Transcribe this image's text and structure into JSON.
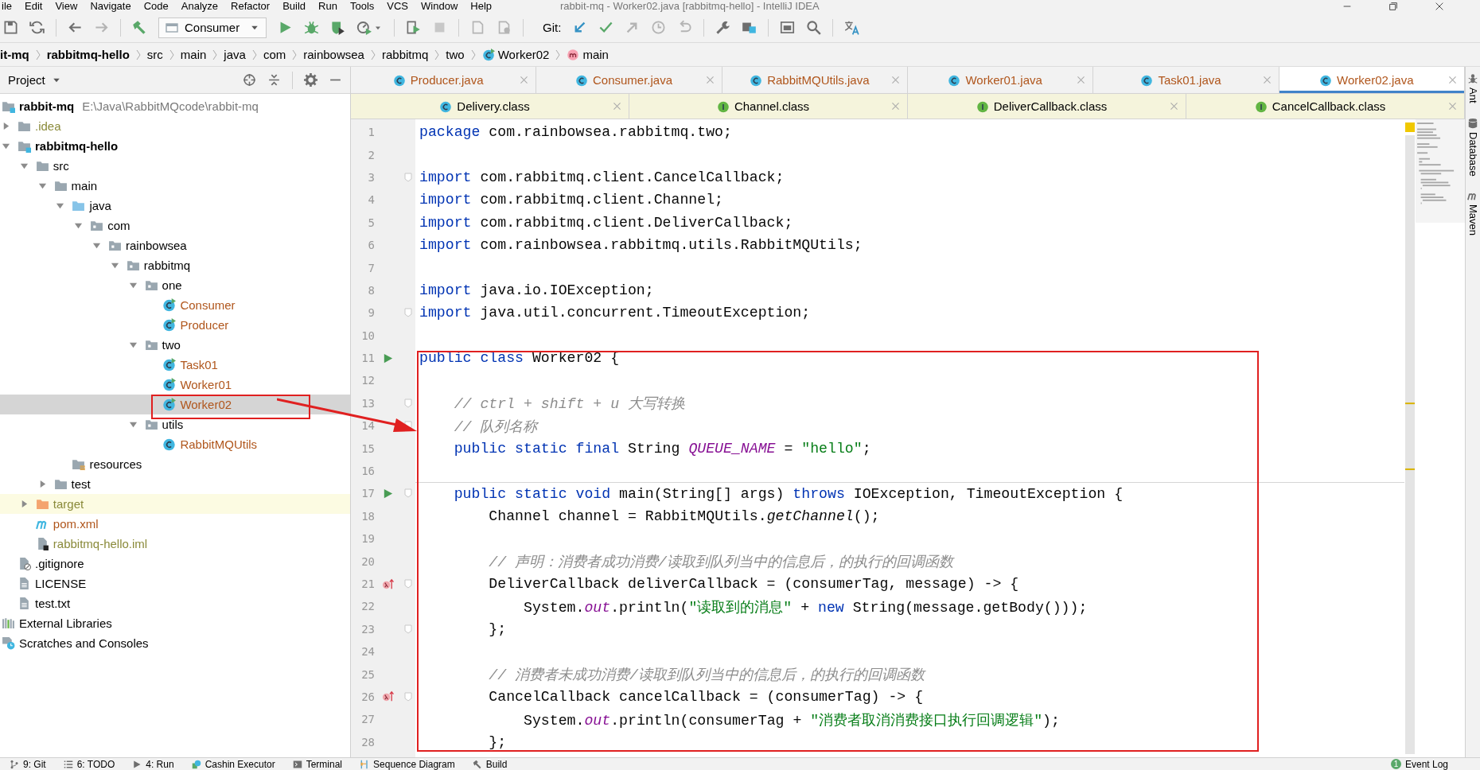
{
  "menu_bar": {
    "items": [
      "ile",
      "Edit",
      "View",
      "Navigate",
      "Code",
      "Analyze",
      "Refactor",
      "Build",
      "Run",
      "Tools",
      "VCS",
      "Window",
      "Help"
    ],
    "title": "rabbit-mq - Worker02.java [rabbitmq-hello] - IntelliJ IDEA"
  },
  "toolbar": {
    "run_configuration": "Consumer",
    "git_label": "Git:"
  },
  "breadcrumbs": [
    {
      "label": "it-mq",
      "kind": "module"
    },
    {
      "label": "rabbitmq-hello",
      "kind": "module"
    },
    {
      "label": "src",
      "kind": "folder"
    },
    {
      "label": "main",
      "kind": "folder"
    },
    {
      "label": "java",
      "kind": "folder"
    },
    {
      "label": "com",
      "kind": "folder"
    },
    {
      "label": "rainbowsea",
      "kind": "folder"
    },
    {
      "label": "rabbitmq",
      "kind": "folder"
    },
    {
      "label": "two",
      "kind": "folder"
    },
    {
      "label": "Worker02",
      "kind": "class"
    },
    {
      "label": "main",
      "kind": "method"
    }
  ],
  "project_panel": {
    "title": "Project",
    "tree": [
      {
        "label": "rabbit-mq",
        "path": "E:\\Java\\RabbitMQcode\\rabbit-mq",
        "kind": "module",
        "selected": false,
        "children": [
          {
            "label": ".idea",
            "kind": "folder",
            "expanded": false,
            "color": "#8a8a3a",
            "selected": false
          },
          {
            "label": "rabbitmq-hello",
            "kind": "module",
            "expanded": true,
            "selected": false,
            "children": [
              {
                "label": "src",
                "kind": "folder",
                "expanded": true,
                "selected": false,
                "children": [
                  {
                    "label": "main",
                    "kind": "folder",
                    "expanded": true,
                    "selected": false,
                    "children": [
                      {
                        "label": "java",
                        "kind": "source-folder",
                        "expanded": true,
                        "selected": false,
                        "children": [
                          {
                            "label": "com",
                            "kind": "package",
                            "expanded": true,
                            "selected": false,
                            "children": [
                              {
                                "label": "rainbowsea",
                                "kind": "package",
                                "expanded": true,
                                "selected": false,
                                "children": [
                                  {
                                    "label": "rabbitmq",
                                    "kind": "package",
                                    "expanded": true,
                                    "selected": false,
                                    "children": [
                                      {
                                        "label": "one",
                                        "kind": "package",
                                        "expanded": true,
                                        "selected": false,
                                        "children": [
                                          {
                                            "label": "Consumer",
                                            "kind": "runnable-class",
                                            "color": "#b0561c",
                                            "selected": false
                                          },
                                          {
                                            "label": "Producer",
                                            "kind": "runnable-class",
                                            "color": "#b0561c",
                                            "selected": false
                                          }
                                        ]
                                      },
                                      {
                                        "label": "two",
                                        "kind": "package",
                                        "expanded": true,
                                        "selected": false,
                                        "children": [
                                          {
                                            "label": "Task01",
                                            "kind": "runnable-class",
                                            "color": "#b0561c",
                                            "selected": false
                                          },
                                          {
                                            "label": "Worker01",
                                            "kind": "runnable-class",
                                            "color": "#b0561c",
                                            "selected": false
                                          },
                                          {
                                            "label": "Worker02",
                                            "kind": "runnable-class",
                                            "color": "#b0561c",
                                            "selected": true
                                          }
                                        ]
                                      },
                                      {
                                        "label": "utils",
                                        "kind": "package",
                                        "expanded": true,
                                        "selected": false,
                                        "children": [
                                          {
                                            "label": "RabbitMQUtils",
                                            "kind": "class",
                                            "color": "#b0561c",
                                            "selected": false
                                          }
                                        ]
                                      }
                                    ]
                                  }
                                ]
                              }
                            ]
                          }
                        ]
                      },
                      {
                        "label": "resources",
                        "kind": "resources-folder",
                        "selected": false
                      }
                    ]
                  },
                  {
                    "label": "test",
                    "kind": "folder",
                    "expanded": false,
                    "selected": false
                  }
                ]
              },
              {
                "label": "target",
                "kind": "excluded-folder",
                "expanded": false,
                "color": "#8a8a3a",
                "selected": false
              },
              {
                "label": "pom.xml",
                "kind": "maven-file",
                "color": "#b0561c",
                "selected": false
              },
              {
                "label": "rabbitmq-hello.iml",
                "kind": "iml-file",
                "color": "#8a8a3a",
                "selected": false
              }
            ]
          },
          {
            "label": ".gitignore",
            "kind": "ignore-file",
            "selected": false
          },
          {
            "label": "LICENSE",
            "kind": "text-file",
            "selected": false
          },
          {
            "label": "test.txt",
            "kind": "text-file",
            "selected": false
          }
        ]
      },
      {
        "label": "External Libraries",
        "kind": "libraries",
        "selected": false
      },
      {
        "label": "Scratches and Consoles",
        "kind": "scratches",
        "selected": false
      }
    ]
  },
  "tab_rows": [
    {
      "tabs": [
        {
          "label": "Producer.java",
          "kind": "class",
          "color": "#b0561c",
          "library": false,
          "selected": false
        },
        {
          "label": "Consumer.java",
          "kind": "class",
          "color": "#b0561c",
          "library": false,
          "selected": false
        },
        {
          "label": "RabbitMQUtils.java",
          "kind": "class",
          "color": "#b0561c",
          "library": false,
          "selected": false
        },
        {
          "label": "Worker01.java",
          "kind": "class",
          "color": "#b0561c",
          "library": false,
          "selected": false
        },
        {
          "label": "Task01.java",
          "kind": "class",
          "color": "#b0561c",
          "library": false,
          "selected": false
        },
        {
          "label": "Worker02.java",
          "kind": "class",
          "color": "#b0561c",
          "library": false,
          "selected": true
        }
      ]
    },
    {
      "tabs": [
        {
          "label": "Delivery.class",
          "kind": "class",
          "library": true,
          "selected": false
        },
        {
          "label": "Channel.class",
          "kind": "interface",
          "library": true,
          "selected": false
        },
        {
          "label": "DeliverCallback.class",
          "kind": "interface",
          "library": true,
          "selected": false
        },
        {
          "label": "CancelCallback.class",
          "kind": "interface",
          "library": true,
          "selected": false
        }
      ]
    }
  ],
  "editor": {
    "lines": [
      {
        "number": "1",
        "fold": false,
        "separator_above": false,
        "segments": [
          {
            "kind": "keyword",
            "text": "package"
          },
          {
            "kind": "plain",
            "text": " com.rainbowsea.rabbitmq.two;"
          }
        ]
      },
      {
        "number": "2",
        "fold": false,
        "separator_above": false
      },
      {
        "number": "3",
        "fold": true,
        "separator_above": false,
        "segments": [
          {
            "kind": "keyword",
            "text": "import"
          },
          {
            "kind": "plain",
            "text": " com.rabbitmq.client.CancelCallback;"
          }
        ]
      },
      {
        "number": "4",
        "fold": false,
        "separator_above": false,
        "segments": [
          {
            "kind": "keyword",
            "text": "import"
          },
          {
            "kind": "plain",
            "text": " com.rabbitmq.client.Channel;"
          }
        ]
      },
      {
        "number": "5",
        "fold": false,
        "separator_above": false,
        "segments": [
          {
            "kind": "keyword",
            "text": "import"
          },
          {
            "kind": "plain",
            "text": " com.rabbitmq.client.DeliverCallback;"
          }
        ]
      },
      {
        "number": "6",
        "fold": false,
        "separator_above": false,
        "segments": [
          {
            "kind": "keyword",
            "text": "import"
          },
          {
            "kind": "plain",
            "text": " com.rainbowsea.rabbitmq.utils.RabbitMQUtils;"
          }
        ]
      },
      {
        "number": "7",
        "fold": false,
        "separator_above": false
      },
      {
        "number": "8",
        "fold": false,
        "separator_above": false,
        "segments": [
          {
            "kind": "keyword",
            "text": "import"
          },
          {
            "kind": "plain",
            "text": " java.io.IOException;"
          }
        ]
      },
      {
        "number": "9",
        "fold": true,
        "separator_above": false,
        "segments": [
          {
            "kind": "keyword",
            "text": "import"
          },
          {
            "kind": "plain",
            "text": " java.util.concurrent.TimeoutException;"
          }
        ]
      },
      {
        "number": "10",
        "fold": false,
        "separator_above": false
      },
      {
        "number": "11",
        "kind": "run",
        "fold": false,
        "separator_above": false,
        "segments": [
          {
            "kind": "keyword",
            "text": "public class"
          },
          {
            "kind": "plain",
            "text": " Worker02 {"
          }
        ]
      },
      {
        "number": "12",
        "fold": false,
        "separator_above": false
      },
      {
        "number": "13",
        "fold": true,
        "separator_above": false,
        "segments": [
          {
            "kind": "comment",
            "text": "    // ctrl + shift + u 大写转换"
          }
        ]
      },
      {
        "number": "14",
        "fold": true,
        "separator_above": false,
        "segments": [
          {
            "kind": "comment",
            "text": "    // 队列名称"
          }
        ]
      },
      {
        "number": "15",
        "fold": false,
        "separator_above": false,
        "segments": [
          {
            "kind": "keyword",
            "text": "    public static final"
          },
          {
            "kind": "plain",
            "text": " String "
          },
          {
            "kind": "constant",
            "text": "QUEUE_NAME"
          },
          {
            "kind": "plain",
            "text": " = "
          },
          {
            "kind": "string",
            "text": "\"hello\""
          },
          {
            "kind": "plain",
            "text": ";"
          }
        ]
      },
      {
        "number": "16",
        "fold": false,
        "separator_above": false
      },
      {
        "number": "17",
        "kind": "run",
        "fold": true,
        "separator_above": true,
        "segments": [
          {
            "kind": "keyword",
            "text": "    public static void"
          },
          {
            "kind": "plain",
            "text": " main(String[] args) "
          },
          {
            "kind": "keyword",
            "text": "throws"
          },
          {
            "kind": "plain",
            "text": " IOException, TimeoutException {"
          }
        ]
      },
      {
        "number": "18",
        "fold": false,
        "separator_above": false,
        "segments": [
          {
            "kind": "plain",
            "text": "        Channel channel = RabbitMQUtils."
          },
          {
            "kind": "static-call",
            "text": "getChannel"
          },
          {
            "kind": "plain",
            "text": "();"
          }
        ]
      },
      {
        "number": "19",
        "fold": false,
        "separator_above": false
      },
      {
        "number": "20",
        "fold": false,
        "separator_above": false,
        "segments": [
          {
            "kind": "comment",
            "text": "        // 声明：消费者成功消费/读取到队列当中的信息后，的执行的回调函数"
          }
        ]
      },
      {
        "number": "21",
        "kind": "lambda",
        "fold": true,
        "separator_above": false,
        "segments": [
          {
            "kind": "plain",
            "text": "        DeliverCallback deliverCallback = (consumerTag, message) -> {"
          }
        ]
      },
      {
        "number": "22",
        "fold": false,
        "separator_above": false,
        "segments": [
          {
            "kind": "plain",
            "text": "            System."
          },
          {
            "kind": "field",
            "text": "out"
          },
          {
            "kind": "plain",
            "text": ".println("
          },
          {
            "kind": "string",
            "text": "\"读取到的消息\""
          },
          {
            "kind": "plain",
            "text": " + "
          },
          {
            "kind": "keyword",
            "text": "new"
          },
          {
            "kind": "plain",
            "text": " String(message.getBody()));"
          }
        ]
      },
      {
        "number": "23",
        "fold": true,
        "separator_above": false,
        "segments": [
          {
            "kind": "plain",
            "text": "        };"
          }
        ]
      },
      {
        "number": "24",
        "fold": false,
        "separator_above": false
      },
      {
        "number": "25",
        "fold": false,
        "separator_above": false,
        "segments": [
          {
            "kind": "comment",
            "text": "        // 消费者未成功消费/读取到队列当中的信息后，的执行的回调函数"
          }
        ]
      },
      {
        "number": "26",
        "kind": "lambda",
        "fold": true,
        "separator_above": false,
        "segments": [
          {
            "kind": "plain",
            "text": "        CancelCallback cancelCallback = (consumerTag) -> {"
          }
        ]
      },
      {
        "number": "27",
        "fold": false,
        "separator_above": false,
        "segments": [
          {
            "kind": "plain",
            "text": "            System."
          },
          {
            "kind": "field",
            "text": "out"
          },
          {
            "kind": "plain",
            "text": ".println(consumerTag + "
          },
          {
            "kind": "string",
            "text": "\"消费者取消消费接口执行回调逻辑\""
          },
          {
            "kind": "plain",
            "text": ");"
          }
        ]
      },
      {
        "number": "28",
        "fold": false,
        "separator_above": false,
        "segments": [
          {
            "kind": "plain",
            "text": "        };"
          }
        ]
      }
    ]
  },
  "right_tool_strip": [
    {
      "label": "Ant",
      "kind": "ant"
    },
    {
      "label": "Database",
      "kind": "database"
    },
    {
      "label": "Maven",
      "kind": "maven"
    }
  ],
  "bottom_tool_strip": {
    "items": [
      {
        "label": "9: Git",
        "kind": "git"
      },
      {
        "label": "6: TODO",
        "kind": "todo"
      },
      {
        "label": "4: Run",
        "kind": "run"
      },
      {
        "label": "Cashin Executor",
        "kind": "executor"
      },
      {
        "label": "Terminal",
        "kind": "terminal"
      },
      {
        "label": "Sequence Diagram",
        "kind": "diagram"
      },
      {
        "label": "Build",
        "kind": "build"
      }
    ],
    "event_log": {
      "label": "Event Log",
      "count": "1"
    }
  }
}
